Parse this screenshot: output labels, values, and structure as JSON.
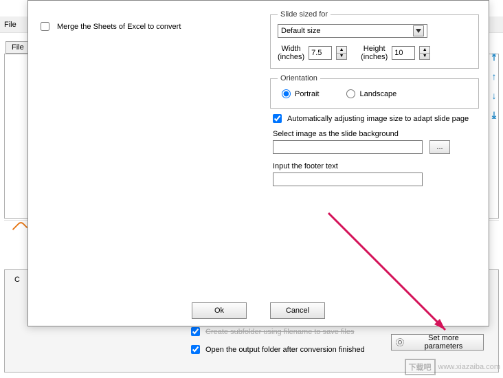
{
  "bg": {
    "menu_file": "File",
    "tab_file": "File",
    "c_label": "C",
    "check_subfolder": "Create subfolder using filename to save files",
    "check_openfolder": "Open the output folder after conversion finished",
    "set_more": "Set more parameters"
  },
  "dialog": {
    "merge_label": "Merge the Sheets of Excel to convert",
    "slide_legend": "Slide sized for",
    "size_value": "Default size",
    "width_label_top": "Width",
    "width_label_bot": "(inches)",
    "width_value": "7.5",
    "height_label_top": "Height",
    "height_label_bot": "(inches)",
    "height_value": "10",
    "orient_legend": "Orientation",
    "orient_portrait": "Portrait",
    "orient_landscape": "Landscape",
    "auto_adjust": "Automatically adjusting image size to adapt slide page",
    "bg_image_label": "Select image as the slide background",
    "browse": "...",
    "footer_label": "Input the footer text",
    "ok": "Ok",
    "cancel": "Cancel"
  },
  "watermark": {
    "site": "下载吧",
    "url": "www.xiazaiba.com"
  }
}
